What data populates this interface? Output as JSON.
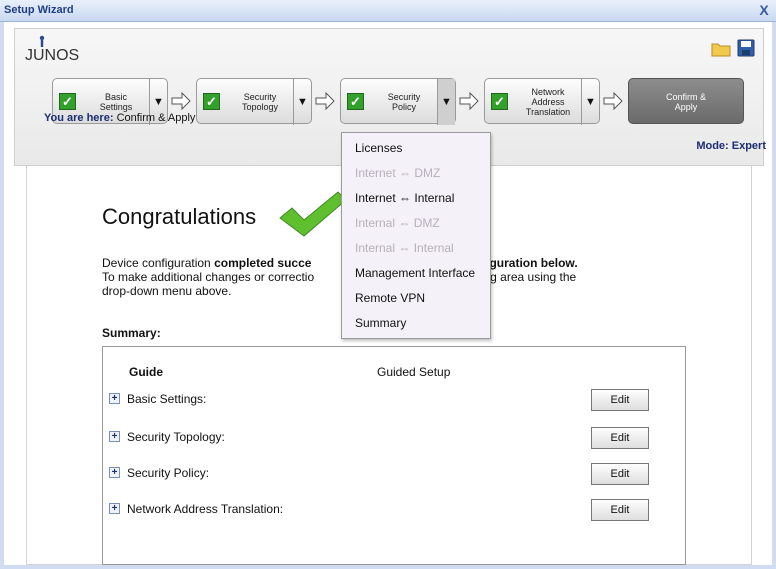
{
  "window": {
    "title": "Setup Wizard",
    "close_glyph": "X"
  },
  "logo": {
    "text": "JUNOS"
  },
  "toolbar": {
    "open_icon": "folder-icon",
    "save_icon": "save-icon"
  },
  "steps": [
    {
      "label": "Basic\nSettings",
      "checked": true
    },
    {
      "label": "Security\nTopology",
      "checked": true
    },
    {
      "label": "Security\nPolicy",
      "checked": true
    },
    {
      "label": "Network\nAddress\nTranslation",
      "checked": true
    },
    {
      "label": "Confirm &\nApply",
      "current": true
    }
  ],
  "status": {
    "you_are_here_prefix": "You are here:",
    "you_are_here": "Confirm & Apply",
    "mode": "Mode: Expert"
  },
  "main": {
    "title": "Congratulations",
    "line1_start": "Device configuration ",
    "line1_bold1": "completed succe",
    "line1_bold2": "your configuration below.",
    "line2_start": "To make additional changes or correctio",
    "line2_end": "ponding area using the",
    "line3": "drop-down menu above.",
    "summary_label": "Summary:",
    "summary_header_guide": "Guide",
    "summary_header_setup": "Guided Setup",
    "rows": [
      {
        "name": "Basic Settings:",
        "edit": "Edit"
      },
      {
        "name": "Security Topology:",
        "edit": "Edit"
      },
      {
        "name": "Security Policy:",
        "edit": "Edit"
      },
      {
        "name": "Network Address Translation:",
        "edit": "Edit"
      }
    ]
  },
  "menu": {
    "items": [
      {
        "label": "Licenses",
        "enabled": true
      },
      {
        "label": "Internet ⇔ DMZ",
        "enabled": false
      },
      {
        "label": "Internet ⇔ Internal",
        "enabled": true
      },
      {
        "label": "Internal ⇔ DMZ",
        "enabled": false
      },
      {
        "label": "Internal ⇔ Internal",
        "enabled": false
      },
      {
        "label": "Management Interface",
        "enabled": true
      },
      {
        "label": "Remote VPN",
        "enabled": true
      },
      {
        "label": "Summary",
        "enabled": true
      }
    ]
  },
  "colors": {
    "accent_blue": "#1a2e72",
    "check_green": "#33a02c"
  }
}
